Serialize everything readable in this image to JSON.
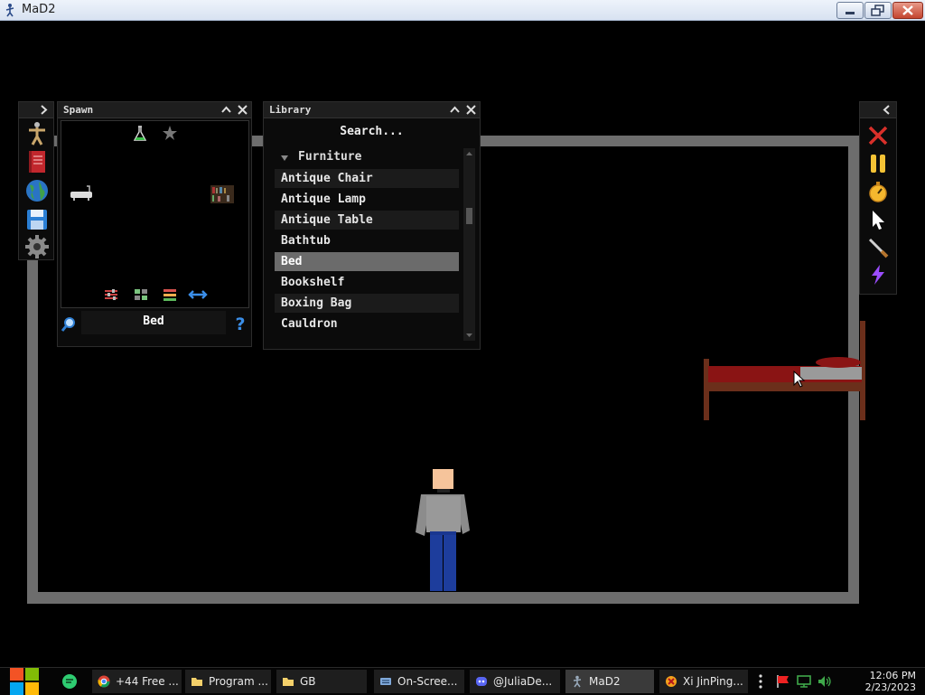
{
  "window": {
    "title": "MaD2"
  },
  "spawn": {
    "title": "Spawn",
    "selected_name": "Bed",
    "preview_items": [
      "bathtub",
      "bookshelf"
    ]
  },
  "library": {
    "title": "Library",
    "search_placeholder": "Search...",
    "category": "Furniture",
    "items": [
      "Antique Chair",
      "Antique Lamp",
      "Antique Table",
      "Bathtub",
      "Bed",
      "Bookshelf",
      "Boxing Bag",
      "Cauldron"
    ],
    "selected": "Bed"
  },
  "left_toolbar": [
    "ragdoll-icon",
    "book-icon",
    "globe-icon",
    "save-icon",
    "settings-gear-icon"
  ],
  "right_toolbar": [
    "close-icon",
    "pause-icon",
    "stopwatch-icon",
    "cursor-icon",
    "knife-icon",
    "lightning-icon"
  ],
  "taskbar": {
    "items": [
      {
        "label": "+44 Free ...",
        "icon": "chrome-icon"
      },
      {
        "label": "Program ...",
        "icon": "folder-icon"
      },
      {
        "label": "GB",
        "icon": "folder-icon"
      },
      {
        "label": "On-Scree...",
        "icon": "keyboard-icon"
      },
      {
        "label": "@JuliaDe...",
        "icon": "discord-icon"
      },
      {
        "label": "MaD2",
        "icon": "mad2-icon"
      },
      {
        "label": "Xi JinPing...",
        "icon": "app-icon"
      }
    ],
    "time": "12:06 PM",
    "date": "2/23/2023"
  },
  "colors": {
    "wall": "#6d6d6d",
    "bed_frame": "#6b2f1b",
    "bed_blanket": "#8a1414",
    "selection": "#6b6b6b"
  }
}
